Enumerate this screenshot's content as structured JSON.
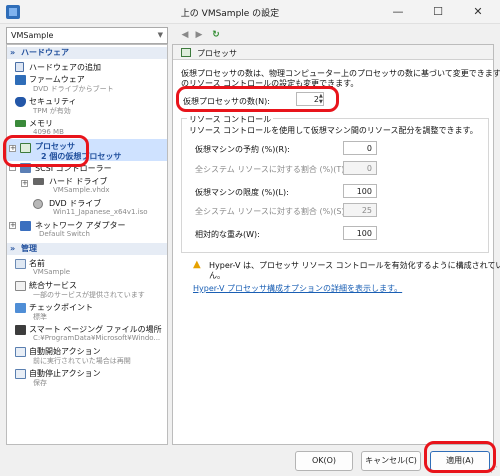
{
  "window": {
    "title": "上の VMSample の設定",
    "minimize": "—",
    "maximize": "☐",
    "close": "✕"
  },
  "nav": {
    "vm_select_value": "VMSample",
    "back": "◀",
    "forward": "▶",
    "refresh": "↻"
  },
  "sidebar": {
    "hardware_header": "ハードウェア",
    "add_hardware": "ハードウェアの追加",
    "firmware": {
      "label": "ファームウェア",
      "sub": "DVD ドライブからブート"
    },
    "security": {
      "label": "セキュリティ",
      "sub": "TPM が有効"
    },
    "memory": {
      "label": "メモリ",
      "sub": "4096 MB"
    },
    "processor": {
      "label": "プロセッサ",
      "sub": "2 個の仮想プロセッサ"
    },
    "scsi": {
      "label": "SCSI コントローラー"
    },
    "hard_drive": {
      "label": "ハード ドライブ",
      "sub": "VMSample.vhdx"
    },
    "dvd_drive": {
      "label": "DVD ドライブ",
      "sub": "Win11_Japanese_x64v1.iso"
    },
    "network": {
      "label": "ネットワーク アダプター",
      "sub": "Default Switch"
    },
    "management_header": "管理",
    "name": {
      "label": "名前",
      "sub": "VMSample"
    },
    "integration": {
      "label": "統合サービス",
      "sub": "一部のサービスが提供されています"
    },
    "checkpoints": {
      "label": "チェックポイント",
      "sub": "標準"
    },
    "paging": {
      "label": "スマート ページング ファイルの場所",
      "sub": "C:¥ProgramData¥Microsoft¥Windo..."
    },
    "auto_start": {
      "label": "自動開始アクション",
      "sub": "前に実行されていた場合は再開"
    },
    "auto_stop": {
      "label": "自動停止アクション",
      "sub": "保存"
    }
  },
  "panel": {
    "title": "プロセッサ",
    "description_line1": "仮想プロセッサの数は、物理コンピューター上のプロセッサの数に基づいて変更できます。他",
    "description_line2": "のリソース コントロールの設定も変更できます。",
    "vproc_label": "仮想プロセッサの数(N):",
    "vproc_value": "2",
    "resource_group": "リソース コントロール",
    "resource_desc": "リソース コントロールを使用して仮想マシン間のリソース配分を調整できます。",
    "reserve_label": "仮想マシンの予約 (%)(R):",
    "reserve_value": "0",
    "reserve_total_label": "全システム リソースに対する割合 (%)(T):",
    "reserve_total_value": "0",
    "limit_label": "仮想マシンの限度 (%)(L):",
    "limit_value": "100",
    "limit_total_label": "全システム リソースに対する割合 (%)(S):",
    "limit_total_value": "25",
    "weight_label": "相対的な重み(W):",
    "weight_value": "100",
    "warning_line1": "Hyper-V は、プロセッサ リソース コントロールを有効化するように構成されていませ",
    "warning_line2": "ん。",
    "link": "Hyper-V プロセッサ構成オプションの詳細を表示します。"
  },
  "buttons": {
    "ok": "OK(O)",
    "cancel": "キャンセル(C)",
    "apply": "適用(A)"
  },
  "colors": {
    "annotation": "#e8141b",
    "selected": "#cfe2ff",
    "link": "#1a5fb4",
    "section_header": "#1f4e9c"
  }
}
